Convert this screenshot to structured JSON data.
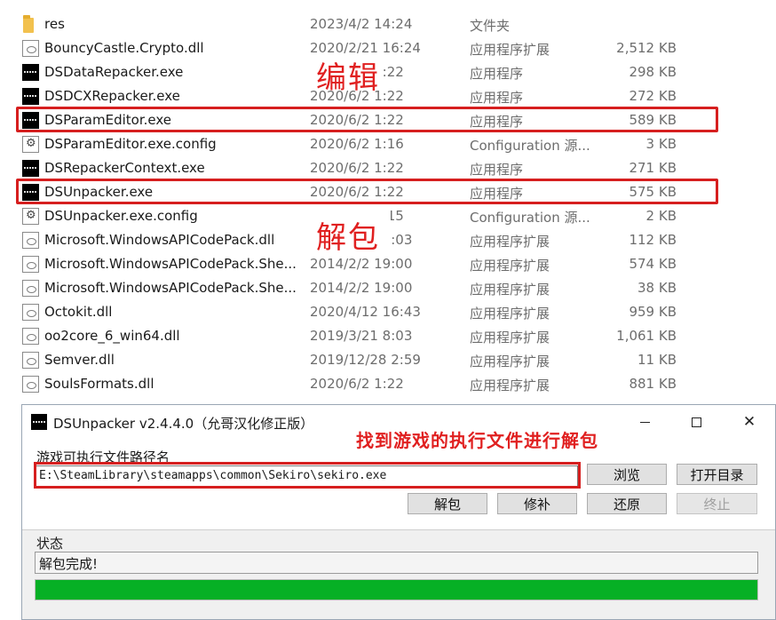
{
  "files": [
    {
      "name": "res",
      "date": "2023/4/2 14:24",
      "type": "文件夹",
      "size": "",
      "icon": "folder-icon"
    },
    {
      "name": "BouncyCastle.Crypto.dll",
      "date": "2020/2/21 16:24",
      "type": "应用程序扩展",
      "size": "2,512 KB",
      "icon": "dll-file-icon"
    },
    {
      "name": "DSDataRepacker.exe",
      "date": "2020/6/2 1:22",
      "type": "应用程序",
      "size": "298 KB",
      "icon": "exe-file-icon"
    },
    {
      "name": "DSDCXRepacker.exe",
      "date": "2020/6/2 1:22",
      "type": "应用程序",
      "size": "272 KB",
      "icon": "exe-file-icon"
    },
    {
      "name": "DSParamEditor.exe",
      "date": "2020/6/2 1:22",
      "type": "应用程序",
      "size": "589 KB",
      "icon": "exe-file-icon"
    },
    {
      "name": "DSParamEditor.exe.config",
      "date": "2020/6/2 1:16",
      "type": "Configuration 源...",
      "size": "3 KB",
      "icon": "config-file-icon"
    },
    {
      "name": "DSRepackerContext.exe",
      "date": "2020/6/2 1:22",
      "type": "应用程序",
      "size": "271 KB",
      "icon": "exe-file-icon"
    },
    {
      "name": "DSUnpacker.exe",
      "date": "2020/6/2 1:22",
      "type": "应用程序",
      "size": "575 KB",
      "icon": "exe-file-icon"
    },
    {
      "name": "DSUnpacker.exe.config",
      "date": "2020/6/2 1:15",
      "type": "Configuration 源...",
      "size": "2 KB",
      "icon": "config-file-icon"
    },
    {
      "name": "Microsoft.WindowsAPICodePack.dll",
      "date": "2019/3/21 8:03",
      "type": "应用程序扩展",
      "size": "112 KB",
      "icon": "dll-file-icon"
    },
    {
      "name": "Microsoft.WindowsAPICodePack.She...",
      "date": "2014/2/2 19:00",
      "type": "应用程序扩展",
      "size": "574 KB",
      "icon": "dll-file-icon"
    },
    {
      "name": "Microsoft.WindowsAPICodePack.She...",
      "date": "2014/2/2 19:00",
      "type": "应用程序扩展",
      "size": "38 KB",
      "icon": "dll-file-icon"
    },
    {
      "name": "Octokit.dll",
      "date": "2020/4/12 16:43",
      "type": "应用程序扩展",
      "size": "959 KB",
      "icon": "dll-file-icon"
    },
    {
      "name": "oo2core_6_win64.dll",
      "date": "2019/3/21 8:03",
      "type": "应用程序扩展",
      "size": "1,061 KB",
      "icon": "dll-file-icon"
    },
    {
      "name": "Semver.dll",
      "date": "2019/12/28 2:59",
      "type": "应用程序扩展",
      "size": "11 KB",
      "icon": "dll-file-icon"
    },
    {
      "name": "SoulsFormats.dll",
      "date": "2020/6/2 1:22",
      "type": "应用程序扩展",
      "size": "881 KB",
      "icon": "dll-file-icon"
    }
  ],
  "annotations": {
    "edit": "编辑",
    "unpack": "解包",
    "dialog_hint": "找到游戏的执行文件进行解包"
  },
  "dialog": {
    "title": "DSUnpacker v2.4.4.0（允哥汉化修正版）",
    "path_label": "游戏可执行文件路径名",
    "path_value": "E:\\SteamLibrary\\steamapps\\common\\Sekiro\\sekiro.exe",
    "browse_label": "浏览",
    "open_dir_label": "打开目录",
    "unpack_label": "解包",
    "patch_label": "修补",
    "restore_label": "还原",
    "abort_label": "终止",
    "status_label": "状态",
    "status_value": "解包完成!",
    "progress": 1.0
  },
  "colors": {
    "highlight": "#d61f1f",
    "progress": "#06b025"
  }
}
